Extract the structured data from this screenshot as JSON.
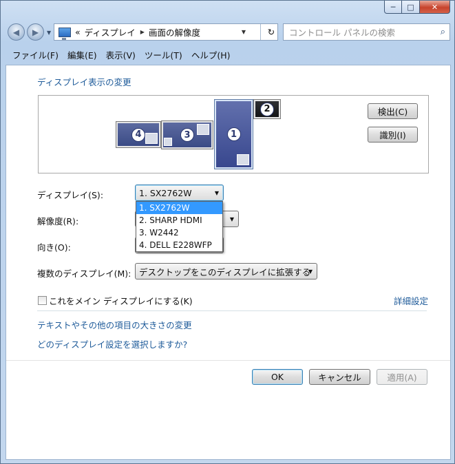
{
  "window": {
    "minimize_glyph": "─",
    "maximize_glyph": "□",
    "close_glyph": "✕"
  },
  "nav": {
    "back_glyph": "◀",
    "forward_glyph": "▶",
    "address": {
      "overflow": "«",
      "crumbs": [
        "ディスプレイ",
        "画面の解像度"
      ],
      "separator": "▶",
      "dropdown_glyph": "▼",
      "refresh_glyph": "↻"
    },
    "search_placeholder": "コントロール パネルの検索",
    "search_glyph": "⌕"
  },
  "menu": [
    "ファイル(F)",
    "編集(E)",
    "表示(V)",
    "ツール(T)",
    "ヘルプ(H)"
  ],
  "heading": "ディスプレイ表示の変更",
  "monitors": [
    {
      "id": "4",
      "label": "4"
    },
    {
      "id": "3",
      "label": "3"
    },
    {
      "id": "1",
      "label": "1"
    },
    {
      "id": "2",
      "label": "2"
    }
  ],
  "buttons": {
    "detect": "検出(C)",
    "identify": "識別(I)",
    "ok": "OK",
    "cancel": "キャンセル",
    "apply": "適用(A)"
  },
  "form": {
    "display_label": "ディスプレイ(S):",
    "display_value": "1. SX2762W",
    "display_options": [
      "1. SX2762W",
      "2. SHARP HDMI",
      "3. W2442",
      "4. DELL E228WFP"
    ],
    "display_selected_index": 0,
    "resolution_label": "解像度(R):",
    "orientation_label": "向き(O):",
    "multi_label": "複数のディスプレイ(M):",
    "multi_value": "デスクトップをこのディスプレイに拡張する",
    "combo_arrow": "▼",
    "main_display_checkbox": "これをメイン ディスプレイにする(K)",
    "main_display_checked": false,
    "advanced_link": "詳細設定"
  },
  "links": {
    "text_size": "テキストやその他の項目の大きさの変更",
    "which_settings": "どのディスプレイ設定を選択しますか?"
  },
  "colors": {
    "link": "#1d5a99",
    "selection": "#3399ff",
    "monitor_blue": "#3b4b86",
    "monitor_dark": "#141517"
  }
}
